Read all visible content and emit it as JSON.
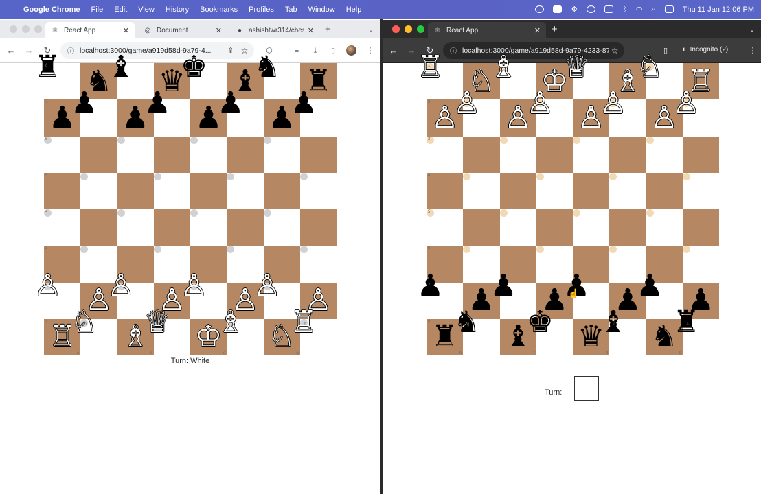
{
  "menubar": {
    "app_name": "Google Chrome",
    "items": [
      "File",
      "Edit",
      "View",
      "History",
      "Bookmarks",
      "Profiles",
      "Tab",
      "Window",
      "Help"
    ],
    "clock": "Thu 11 Jan  12:06 PM"
  },
  "left_window": {
    "tabs": [
      {
        "label": "React App",
        "active": true
      },
      {
        "label": "Document",
        "active": false
      },
      {
        "label": "ashishtwr314/ches",
        "active": false
      }
    ],
    "url": "localhost:3000/game/a919d58d-9a79-4...",
    "turn_text": "Turn: White",
    "board": [
      [
        "♜",
        "♞",
        "♝",
        "♛",
        "♚",
        "♝",
        "♞",
        "♜"
      ],
      [
        "♟",
        "♟",
        "♟",
        "♟",
        "♟",
        "♟",
        "♟",
        "♟"
      ],
      [
        "",
        "",
        "",
        "",
        "",
        "",
        "",
        ""
      ],
      [
        "",
        "",
        "",
        "",
        "",
        "",
        "",
        ""
      ],
      [
        "",
        "",
        "",
        "",
        "",
        "",
        "",
        ""
      ],
      [
        "",
        "",
        "",
        "",
        "",
        "",
        "",
        ""
      ],
      [
        "♙",
        "♙",
        "♙",
        "♙",
        "♙",
        "♙",
        "♙",
        "♙"
      ],
      [
        "♖",
        "♘",
        "♗",
        "♕",
        "♔",
        "♗",
        "♘",
        "♖"
      ]
    ],
    "board_colors": [
      [
        "black",
        "black",
        "black",
        "black",
        "black",
        "black",
        "black",
        "black"
      ],
      [
        "black",
        "black",
        "black",
        "black",
        "black",
        "black",
        "black",
        "black"
      ],
      [
        "",
        "",
        "",
        "",
        "",
        "",
        "",
        ""
      ],
      [
        "",
        "",
        "",
        "",
        "",
        "",
        "",
        ""
      ],
      [
        "",
        "",
        "",
        "",
        "",
        "",
        "",
        ""
      ],
      [
        "",
        "",
        "",
        "",
        "",
        "",
        "",
        ""
      ],
      [
        "white",
        "white",
        "white",
        "white",
        "white",
        "white",
        "white",
        "white"
      ],
      [
        "white",
        "white",
        "white",
        "white",
        "white",
        "white",
        "white",
        "white"
      ]
    ],
    "ranks": [
      "8",
      "7",
      "6",
      "5",
      "4",
      "3",
      "2",
      "1"
    ],
    "files": [
      "a",
      "b",
      "c",
      "d",
      "e",
      "f",
      "g",
      "h"
    ]
  },
  "right_window": {
    "tabs": [
      {
        "label": "React App",
        "active": true
      }
    ],
    "url": "localhost:3000/game/a919d58d-9a79-4233-873...",
    "incognito_label": "Incognito (2)",
    "turn_label": "Turn:",
    "board": [
      [
        "♖",
        "♘",
        "♗",
        "♔",
        "♕",
        "♗",
        "♘",
        "♖"
      ],
      [
        "♙",
        "♙",
        "♙",
        "♙",
        "♙",
        "♙",
        "♙",
        "♙"
      ],
      [
        "",
        "",
        "",
        "",
        "",
        "",
        "",
        ""
      ],
      [
        "",
        "",
        "",
        "",
        "",
        "",
        "",
        ""
      ],
      [
        "",
        "",
        "",
        "",
        "",
        "",
        "",
        ""
      ],
      [
        "",
        "",
        "",
        "",
        "",
        "",
        "",
        ""
      ],
      [
        "♟",
        "♟",
        "♟",
        "♟",
        "♟",
        "♟",
        "♟",
        "♟"
      ],
      [
        "♜",
        "♞",
        "♝",
        "♚",
        "♛",
        "♝",
        "♞",
        "♜"
      ]
    ],
    "board_colors": [
      [
        "white",
        "white",
        "white",
        "white",
        "white",
        "white",
        "white",
        "white"
      ],
      [
        "white",
        "white",
        "white",
        "white",
        "white",
        "white",
        "white",
        "white"
      ],
      [
        "",
        "",
        "",
        "",
        "",
        "",
        "",
        ""
      ],
      [
        "",
        "",
        "",
        "",
        "",
        "",
        "",
        ""
      ],
      [
        "",
        "",
        "",
        "",
        "",
        "",
        "",
        ""
      ],
      [
        "",
        "",
        "",
        "",
        "",
        "",
        "",
        ""
      ],
      [
        "black",
        "black",
        "black",
        "black",
        "black",
        "black",
        "black",
        "black"
      ],
      [
        "black",
        "black",
        "black",
        "black",
        "black",
        "black",
        "black",
        "black"
      ]
    ],
    "ranks": [
      "1",
      "2",
      "3",
      "4",
      "5",
      "6",
      "7",
      "8"
    ],
    "files": [
      "h",
      "g",
      "f",
      "e",
      "d",
      "c",
      "b",
      "a"
    ]
  },
  "colors": {
    "light_square": "#f0d9b5",
    "dark_square": "#b58863",
    "menubar": "#5765c9"
  }
}
